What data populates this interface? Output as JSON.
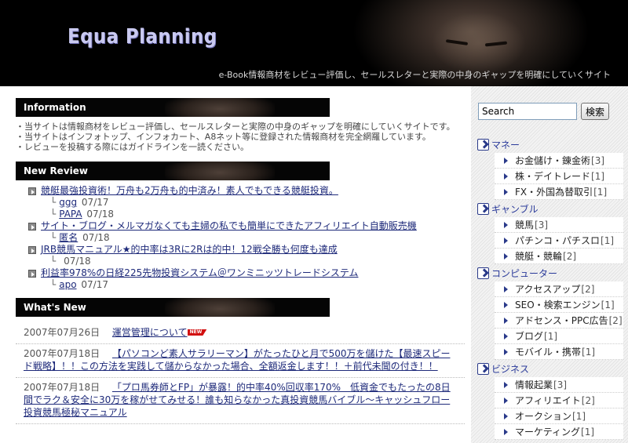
{
  "header": {
    "title": "Equa Planning",
    "subtitle": "e-Book情報商材をレビュー評価し、セールスレターと実際の中身のギャップを明確にしていくサイト"
  },
  "information": {
    "heading": "Information",
    "items": [
      "・当サイトは情報商材をレビュー評価し、セールスレターと実際の中身のギャップを明確にしていくサイトです。",
      "・当サイトはインフォトップ、インフォカート、A8ネット等に登録された情報商材を完全網羅しています。",
      "・レビューを投稿する際にはガイドラインを一読ください。"
    ]
  },
  "new_review": {
    "heading": "New Review",
    "items": [
      {
        "title": "競艇最強投資術！万舟も2万舟も的中済み！素人でもできる競艇投資。",
        "replies": [
          {
            "name": "ggg",
            "date": "07/17"
          },
          {
            "name": "PAPA",
            "date": "07/18"
          }
        ]
      },
      {
        "title": "サイト・ブログ・メルマガなくても主婦の私でも簡単にできたアフィリエイト自動販売機",
        "replies": [
          {
            "name": "匿名",
            "date": "07/18"
          }
        ]
      },
      {
        "title": "JRB競馬マニュアル★的中率は3Rに2Rは的中！12戦全勝も何度も達成",
        "replies": [
          {
            "name": "",
            "date": "07/18"
          }
        ]
      },
      {
        "title": "利益率978%の日経225先物投資システム＠ワンミニッツトレードシステム",
        "replies": [
          {
            "name": "apo",
            "date": "07/17"
          }
        ]
      }
    ]
  },
  "whats_new": {
    "heading": "What's New",
    "new_badge": "NEW",
    "items": [
      {
        "date": "2007年07月26日",
        "title": "運営管理について"
      },
      {
        "date": "2007年07月18日",
        "title": "【パソコンど素人サラリーマン】がたったひと月で500万を儲けた【最速スピード戦略】！！この方法を実践して儲からなかった場合、全額返金します！！＋前代未聞の付き！！"
      },
      {
        "date": "2007年07月18日",
        "title": "「プロ馬券師とFP」が暴露！的中率40%回収率170%　低資金でもたったの8日間でラク＆安全に30万を稼がせてみせる！誰も知らなかった真投資競馬バイブル～キャッシュフロー投資競馬極秘マニュアル"
      }
    ]
  },
  "sidebar": {
    "search": {
      "value": "Search",
      "button": "検索"
    },
    "categories": [
      {
        "name": "マネー",
        "items": [
          {
            "label": "お金儲け・錬金術",
            "count": "[3]"
          },
          {
            "label": "株・デイトレード",
            "count": "[1]"
          },
          {
            "label": "FX・外国為替取引",
            "count": "[1]"
          }
        ]
      },
      {
        "name": "ギャンブル",
        "items": [
          {
            "label": "競馬",
            "count": "[3]"
          },
          {
            "label": "パチンコ・パチスロ",
            "count": "[1]"
          },
          {
            "label": "競艇・競輪",
            "count": "[2]"
          }
        ]
      },
      {
        "name": "コンピューター",
        "items": [
          {
            "label": "アクセスアップ",
            "count": "[2]"
          },
          {
            "label": "SEO・検索エンジン",
            "count": "[1]"
          },
          {
            "label": "アドセンス・PPC広告",
            "count": "[2]"
          },
          {
            "label": "ブログ",
            "count": "[1]"
          },
          {
            "label": "モバイル・携帯",
            "count": "[1]"
          }
        ]
      },
      {
        "name": "ビジネス",
        "items": [
          {
            "label": "情報起業",
            "count": "[3]"
          },
          {
            "label": "アフィリエイト",
            "count": "[2]"
          },
          {
            "label": "オークション",
            "count": "[1]"
          },
          {
            "label": "マーケティング",
            "count": "[1]"
          }
        ]
      }
    ]
  }
}
